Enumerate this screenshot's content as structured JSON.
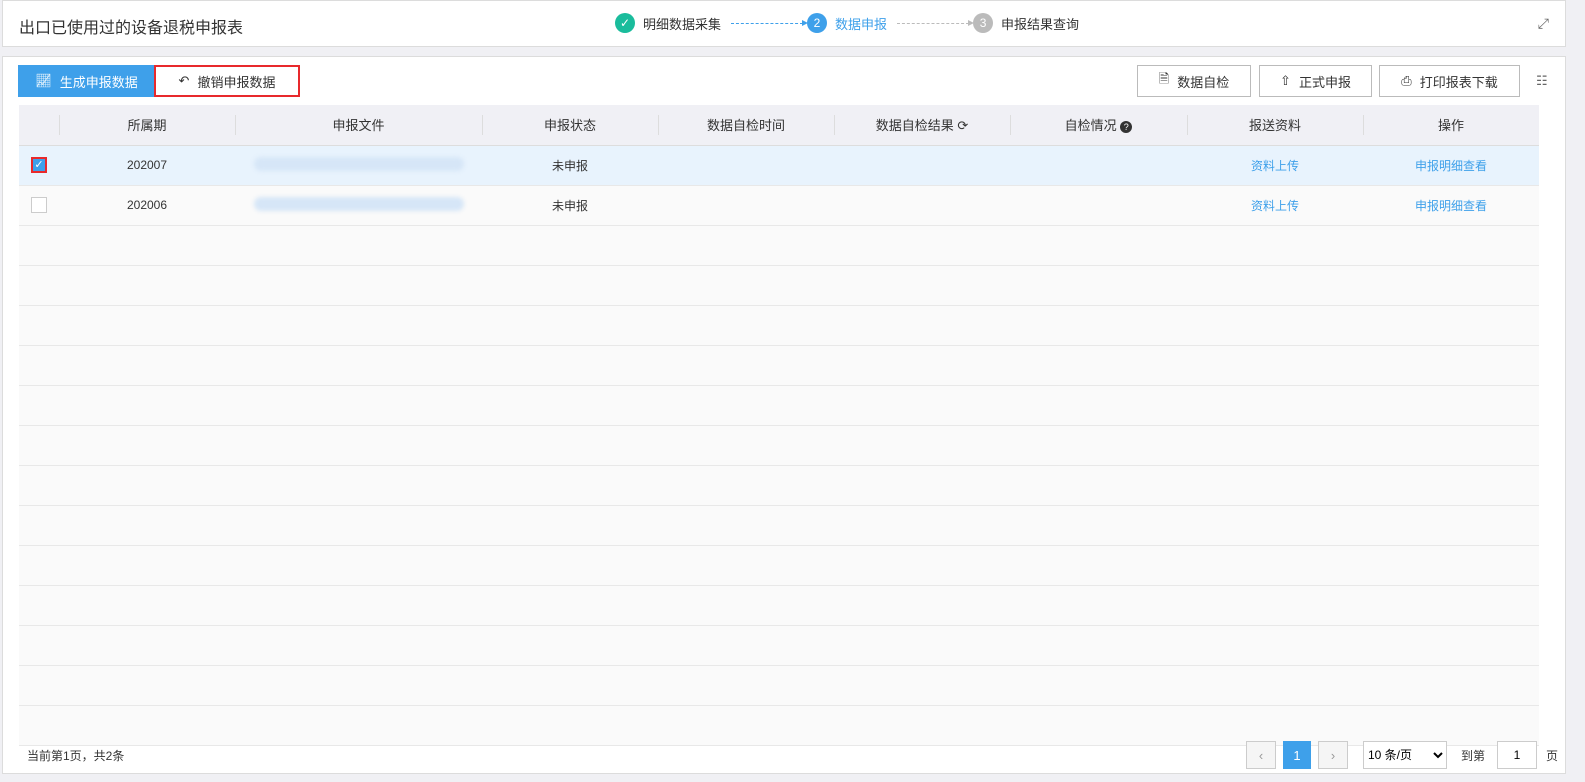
{
  "header": {
    "title": "出口已使用过的设备退税申报表",
    "steps": [
      {
        "num": "✓",
        "label": "明细数据采集",
        "color": "#1abc9c"
      },
      {
        "num": "2",
        "label": "数据申报",
        "color": "#3ea0ea"
      },
      {
        "num": "3",
        "label": "申报结果查询",
        "color": "#bbbbbb"
      }
    ]
  },
  "toolbar": {
    "generate": "生成申报数据",
    "revoke": "撤销申报数据",
    "selfcheck": "数据自检",
    "submit": "正式申报",
    "print": "打印报表下载"
  },
  "table": {
    "columns": [
      "所属期",
      "申报文件",
      "申报状态",
      "数据自检时间",
      "数据自检结果",
      "自检情况",
      "报送资料",
      "操作"
    ],
    "rows": [
      {
        "period": "202007",
        "status": "未申报",
        "upload": "资料上传",
        "action": "申报明细查看",
        "checked": true
      },
      {
        "period": "202006",
        "status": "未申报",
        "upload": "资料上传",
        "action": "申报明细查看",
        "checked": false
      }
    ]
  },
  "footer": {
    "summary": "当前第1页，共2条",
    "page": "1",
    "page_size": "10 条/页",
    "goto": "到第",
    "goto_value": "1",
    "page_unit": "页"
  }
}
